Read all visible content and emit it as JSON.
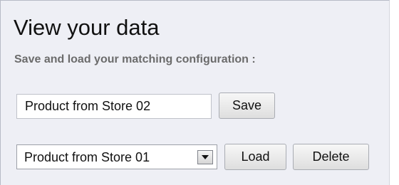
{
  "header": {
    "title": "View your data",
    "subtitle": "Save and load your matching configuration :"
  },
  "save_row": {
    "input_value": "Product from Store 02",
    "save_label": "Save"
  },
  "load_row": {
    "selected_value": "Product from Store 01",
    "load_label": "Load",
    "delete_label": "Delete"
  },
  "icons": {
    "dropdown": "chevron-down-icon"
  }
}
